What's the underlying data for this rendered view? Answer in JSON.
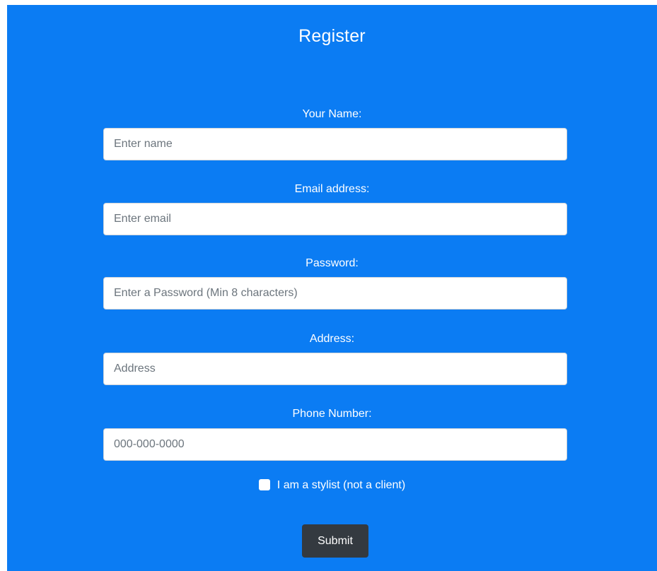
{
  "form": {
    "title": "Register",
    "fields": [
      {
        "label": "Your Name:",
        "placeholder": "Enter name",
        "value": ""
      },
      {
        "label": "Email address:",
        "placeholder": "Enter email",
        "value": ""
      },
      {
        "label": "Password:",
        "placeholder": "Enter a Password (Min 8 characters)",
        "value": ""
      },
      {
        "label": "Address:",
        "placeholder": "Address",
        "value": ""
      },
      {
        "label": "Phone Number:",
        "placeholder": "000-000-0000",
        "value": ""
      }
    ],
    "checkbox_label": "I am a stylist (not a client)",
    "checkbox_checked": false,
    "submit_label": "Submit"
  },
  "colors": {
    "background": "#0b7cf3",
    "button": "#343a40",
    "text": "#ffffff"
  }
}
